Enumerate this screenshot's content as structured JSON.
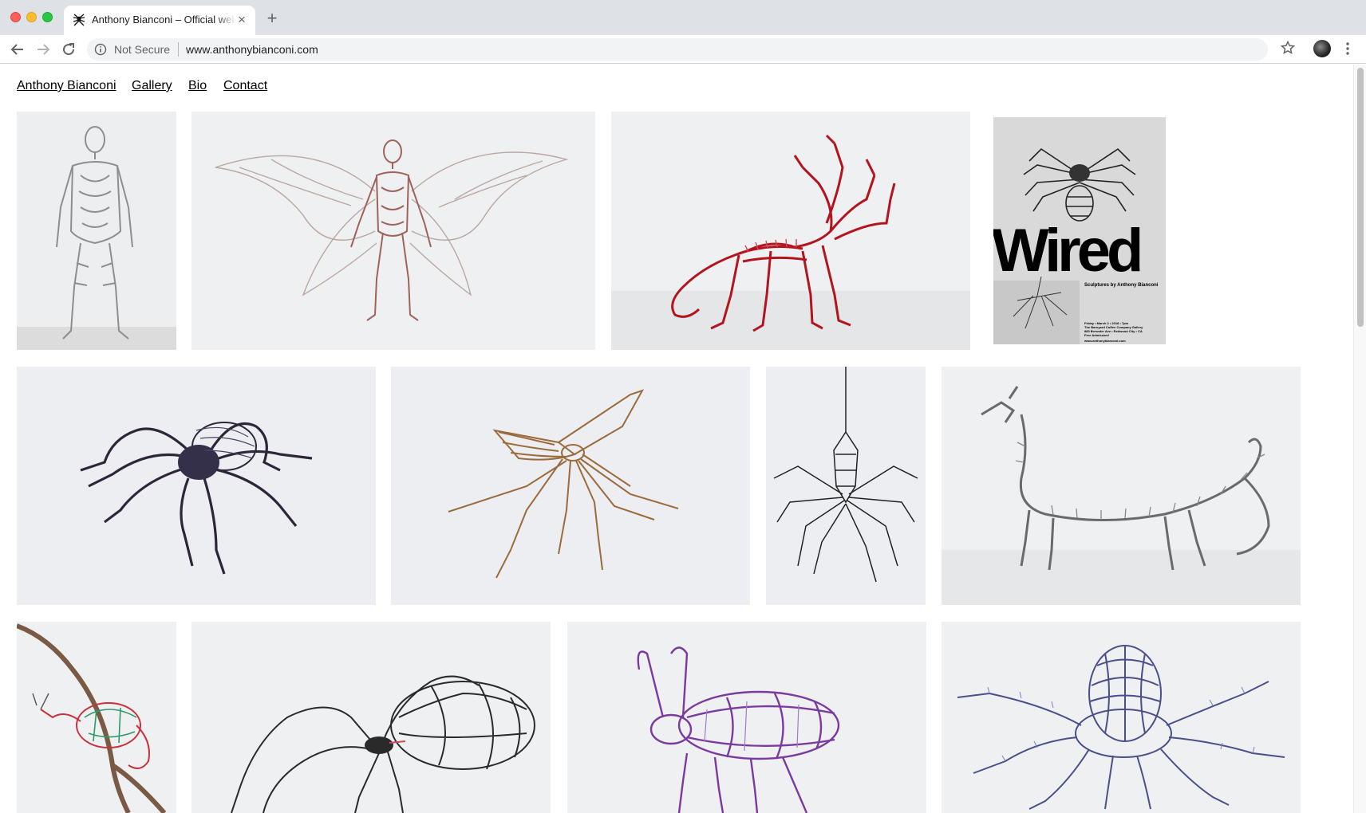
{
  "browser": {
    "tab_title": "Anthony Bianconi – Official website",
    "tab_close": "×",
    "new_tab": "+",
    "security_label": "Not Secure",
    "url": "www.anthonybianconi.com"
  },
  "site_nav": {
    "home": "Anthony Bianconi",
    "gallery": "Gallery",
    "bio": "Bio",
    "contact": "Contact"
  },
  "poster": {
    "title": "Wired",
    "subtitle": "Sculptures by Anthony Bianconi",
    "details": [
      "Friday • March 2 • 2018 • 7pm",
      "The Barnyard Coffee Company Gallery",
      "880 Brewster Ave • Redwood City • CA",
      "Free Admission!"
    ],
    "url": "www.anthonybianconi.com"
  },
  "gallery": [
    {
      "subject": "wire human figure",
      "wire_color": "#8e8e8e"
    },
    {
      "subject": "winged wire figure",
      "wire_color": "#a0635a"
    },
    {
      "subject": "red wire dragon",
      "wire_color": "#b4141e"
    },
    {
      "subject": "Wired exhibition poster",
      "wire_color": "#222222"
    },
    {
      "subject": "dark wire spider",
      "wire_color": "#2c2638"
    },
    {
      "subject": "copper wire mosquito",
      "wire_color": "#9c6b3c"
    },
    {
      "subject": "black wire daddy longlegs",
      "wire_color": "#222222"
    },
    {
      "subject": "silver wire serpent dragon",
      "wire_color": "#6a6a6a"
    },
    {
      "subject": "wire chameleon on branch",
      "wire_color": "#c8323c"
    },
    {
      "subject": "black wire spider",
      "wire_color": "#2a2a2a"
    },
    {
      "subject": "purple wire beetle",
      "wire_color": "#7a3aa0"
    },
    {
      "subject": "blue wire octopus",
      "wire_color": "#4a4f8a"
    }
  ]
}
